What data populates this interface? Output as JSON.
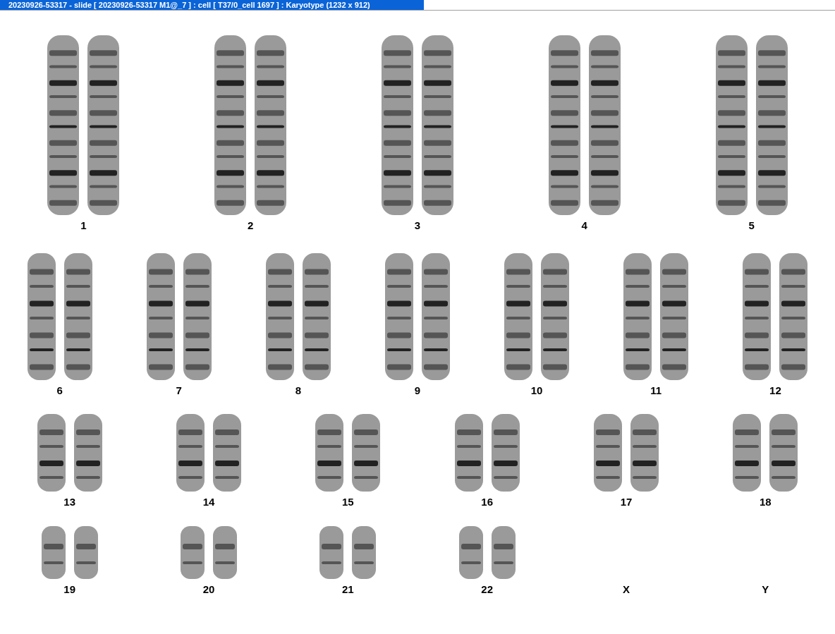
{
  "window": {
    "title": "20230926-53317 - slide [ 20230926-53317 M1@_7 ] : cell [ T37/0_cell 1697 ] : Karyotype  (1232 x 912)"
  },
  "rows": [
    {
      "items": [
        {
          "label": "1",
          "kind": "pair"
        },
        {
          "label": "2",
          "kind": "pair"
        },
        {
          "label": "3",
          "kind": "pair"
        },
        {
          "label": "4",
          "kind": "pair"
        },
        {
          "label": "5",
          "kind": "pair"
        }
      ]
    },
    {
      "items": [
        {
          "label": "6",
          "kind": "pair"
        },
        {
          "label": "7",
          "kind": "pair"
        },
        {
          "label": "8",
          "kind": "pair"
        },
        {
          "label": "9",
          "kind": "pair"
        },
        {
          "label": "10",
          "kind": "pair"
        },
        {
          "label": "11",
          "kind": "pair"
        },
        {
          "label": "12",
          "kind": "pair"
        }
      ]
    },
    {
      "items": [
        {
          "label": "13",
          "kind": "pair"
        },
        {
          "label": "14",
          "kind": "pair"
        },
        {
          "label": "15",
          "kind": "pair"
        },
        {
          "label": "16",
          "kind": "pair"
        },
        {
          "label": "17",
          "kind": "pair"
        },
        {
          "label": "18",
          "kind": "pair"
        }
      ]
    },
    {
      "items": [
        {
          "label": "19",
          "kind": "pair"
        },
        {
          "label": "20",
          "kind": "pair"
        },
        {
          "label": "21",
          "kind": "pair"
        },
        {
          "label": "22",
          "kind": "pair"
        },
        {
          "label": "X",
          "kind": "empty"
        },
        {
          "label": "Y",
          "kind": "empty"
        }
      ]
    }
  ]
}
